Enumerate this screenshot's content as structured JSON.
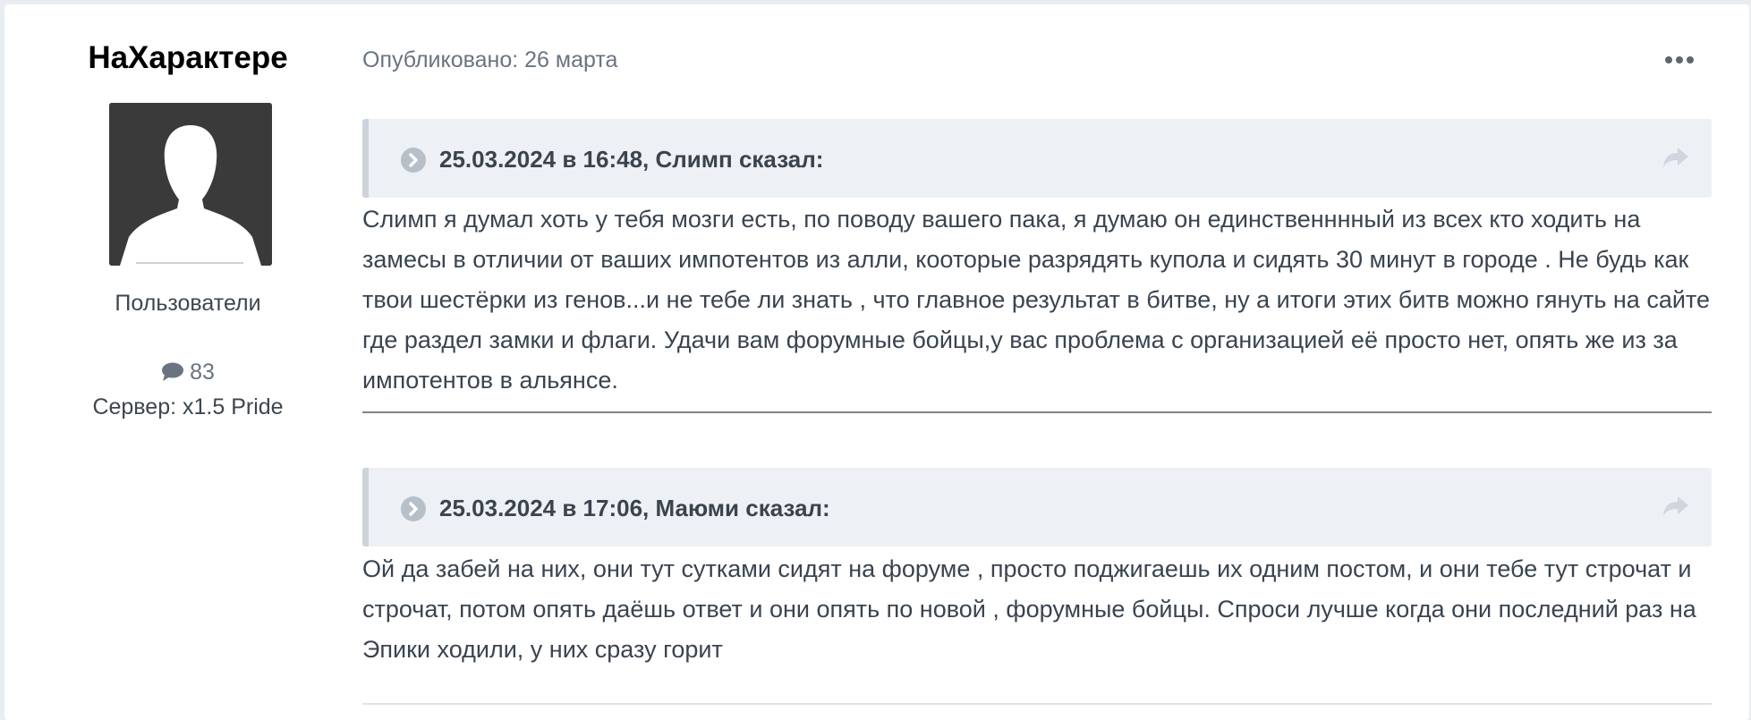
{
  "author": {
    "name": "НаХарактере",
    "group": "Пользователи",
    "post_count": "83",
    "server": "Сервер: x1.5 Pride",
    "avatar_icon": "default-user-silhouette-icon",
    "post_count_icon": "comment-icon"
  },
  "post": {
    "published": "Опубликовано: 26 марта",
    "more_icon": "ellipsis-icon",
    "quotes": [
      {
        "citation": "25.03.2024 в 16:48, Слимп сказал:",
        "reply_text": "Слимп я думал хоть у тебя мозги есть, по поводу вашего пака, я думаю он единственннный из всех кто ходить на замесы в отличии от ваших импотентов из алли, кооторые разрядять купола и сидять 30 минут в городе . Не будь как твои шестёрки из генов...и не тебе ли знать , что главное результат в битве, ну а итоги этих битв можно гянуть на сайте где раздел замки и флаги. Удачи вам форумные бойцы,у вас проблема с организацией её просто нет, опять же из за импотентов в альянсе."
      },
      {
        "citation": "25.03.2024 в 17:06, Маюми сказал:",
        "reply_text": "Ой да забей на них, они тут сутками сидят на форуме , просто поджигаешь их одним постом, и они тебе тут строчат  и строчат, потом опять даёшь ответ и они опять по новой , форумные бойцы. Спроси лучше когда они последний раз на Эпики ходили, у них сразу горит"
      }
    ]
  },
  "colors": {
    "page_bg": "#e9edf2",
    "card_bg": "#ffffff",
    "quote_bg": "#edf1f5",
    "text": "#3a4450",
    "muted": "#6a7480"
  }
}
